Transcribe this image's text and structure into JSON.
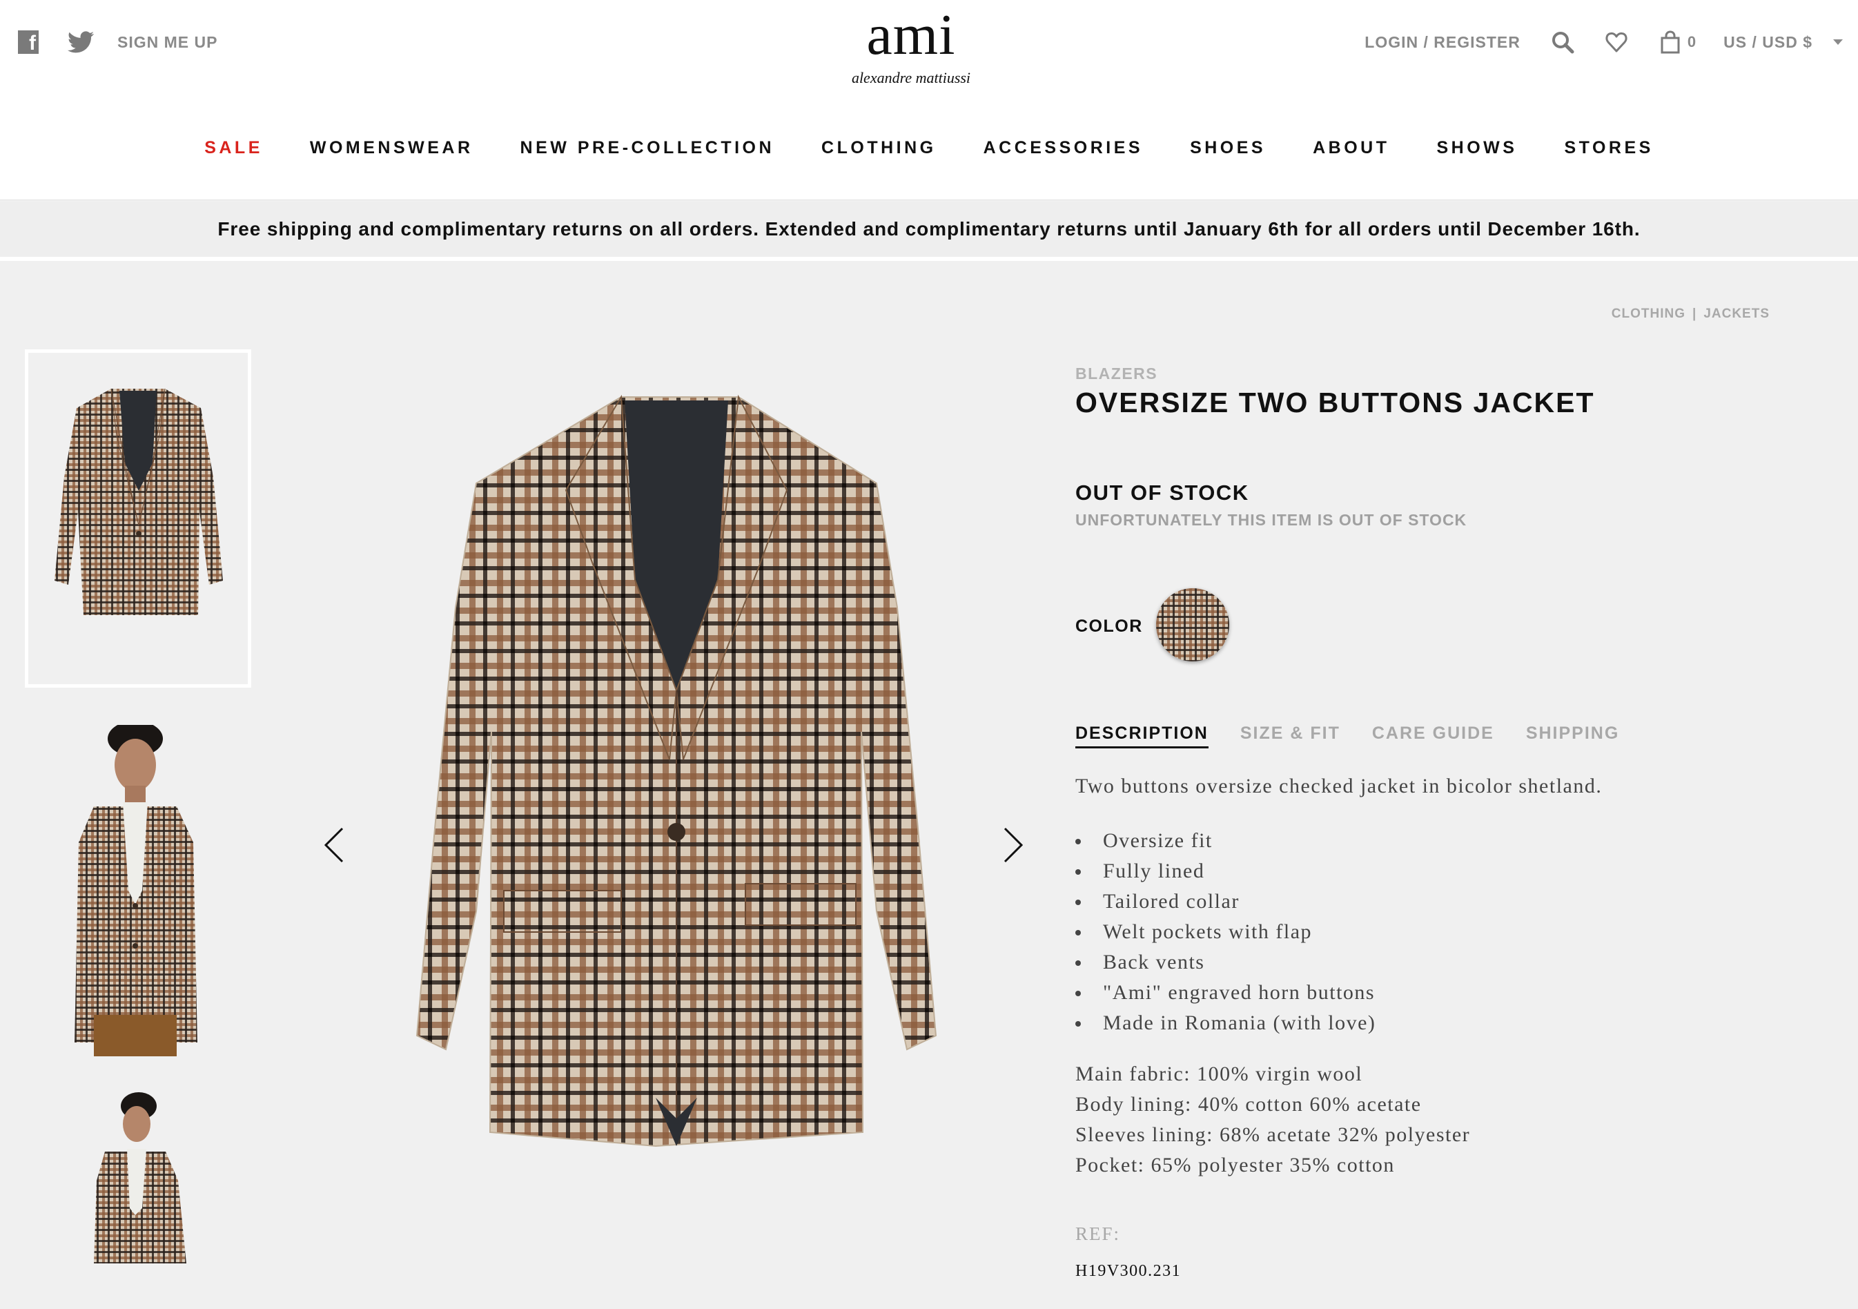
{
  "header": {
    "social": {
      "facebook_icon": "facebook-icon",
      "twitter_icon": "twitter-icon"
    },
    "signup_label": "SIGN ME UP",
    "logo": {
      "word": "ami",
      "tagline": "alexandre mattiussi"
    },
    "login_label": "LOGIN / REGISTER",
    "bag_count": "0",
    "currency_label": "US / USD $"
  },
  "nav": {
    "items": [
      {
        "label": "SALE",
        "highlight": true
      },
      {
        "label": "WOMENSWEAR"
      },
      {
        "label": "NEW PRE-COLLECTION"
      },
      {
        "label": "CLOTHING"
      },
      {
        "label": "ACCESSORIES"
      },
      {
        "label": "SHOES"
      },
      {
        "label": "ABOUT"
      },
      {
        "label": "SHOWS"
      },
      {
        "label": "STORES"
      }
    ],
    "sale_color": "#d9231c"
  },
  "promo": {
    "text": "Free shipping and complimentary returns on all orders. Extended and complimentary returns until January 6th for all orders until December 16th."
  },
  "breadcrumb": {
    "items": [
      "CLOTHING",
      "JACKETS"
    ],
    "separator": "|"
  },
  "gallery": {
    "thumbnails": [
      "jacket-flat-thumbnail",
      "model-front-thumbnail",
      "model-side-thumbnail"
    ],
    "prev_icon": "chevron-left-icon",
    "next_icon": "chevron-right-icon"
  },
  "product": {
    "category": "BLAZERS",
    "title": "OVERSIZE TWO BUTTONS JACKET",
    "stock_title": "OUT OF STOCK",
    "stock_subtitle": "UNFORTUNATELY THIS ITEM IS OUT OF STOCK",
    "color_label": "COLOR",
    "tabs": [
      "DESCRIPTION",
      "SIZE & FIT",
      "CARE GUIDE",
      "SHIPPING"
    ],
    "active_tab": 0,
    "description": "Two buttons oversize checked jacket in bicolor shetland.",
    "features": [
      "Oversize fit",
      "Fully lined",
      "Tailored collar",
      "Welt pockets with flap",
      "Back vents",
      "\"Ami\" engraved horn buttons",
      "Made in Romania (with love)"
    ],
    "composition": [
      "Main fabric: 100% virgin wool",
      "Body lining: 40% cotton 60% acetate",
      "Sleeves lining: 68% acetate 32% polyester",
      "Pocket: 65% polyester 35% cotton"
    ],
    "ref_label": "REF:",
    "ref_value": "H19V300.231"
  },
  "colors": {
    "check_beige": "#d8c9b6",
    "check_brown": "#8a5a3a",
    "check_dark": "#2a211c",
    "lining": "#2b2e33"
  }
}
